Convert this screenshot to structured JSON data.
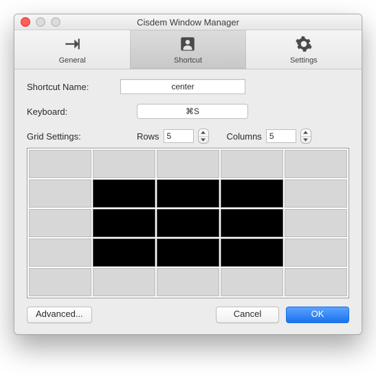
{
  "window": {
    "title": "Cisdem Window Manager"
  },
  "toolbar": {
    "general": "General",
    "shortcut": "Shortcut",
    "settings": "Settings"
  },
  "form": {
    "shortcut_name_label": "Shortcut Name:",
    "shortcut_name_value": "center",
    "keyboard_label": "Keyboard:",
    "keyboard_value": "⌘S",
    "grid_label": "Grid Settings:",
    "rows_label": "Rows",
    "rows_value": "5",
    "columns_label": "Columns",
    "columns_value": "5"
  },
  "grid": {
    "rows": 5,
    "cols": 5,
    "selected": [
      [
        1,
        1
      ],
      [
        1,
        2
      ],
      [
        1,
        3
      ],
      [
        2,
        1
      ],
      [
        2,
        2
      ],
      [
        2,
        3
      ],
      [
        3,
        1
      ],
      [
        3,
        2
      ],
      [
        3,
        3
      ]
    ]
  },
  "buttons": {
    "advanced": "Advanced...",
    "cancel": "Cancel",
    "ok": "OK"
  }
}
